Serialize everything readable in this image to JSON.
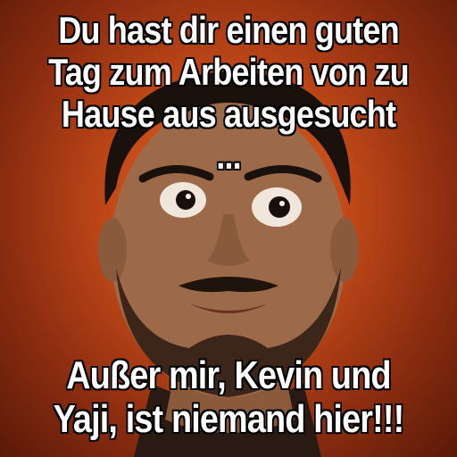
{
  "top_text": [
    "Du hast dir einen guten",
    "Tag zum Arbeiten von zu",
    "Hause aus ausgesucht",
    "..."
  ],
  "bottom_text": [
    "Außer mir, Kevin und",
    "Yaji, ist niemand hier!!!"
  ],
  "colors": {
    "background": "#c44a18",
    "text": "#ffffff",
    "outline": "#000000"
  }
}
